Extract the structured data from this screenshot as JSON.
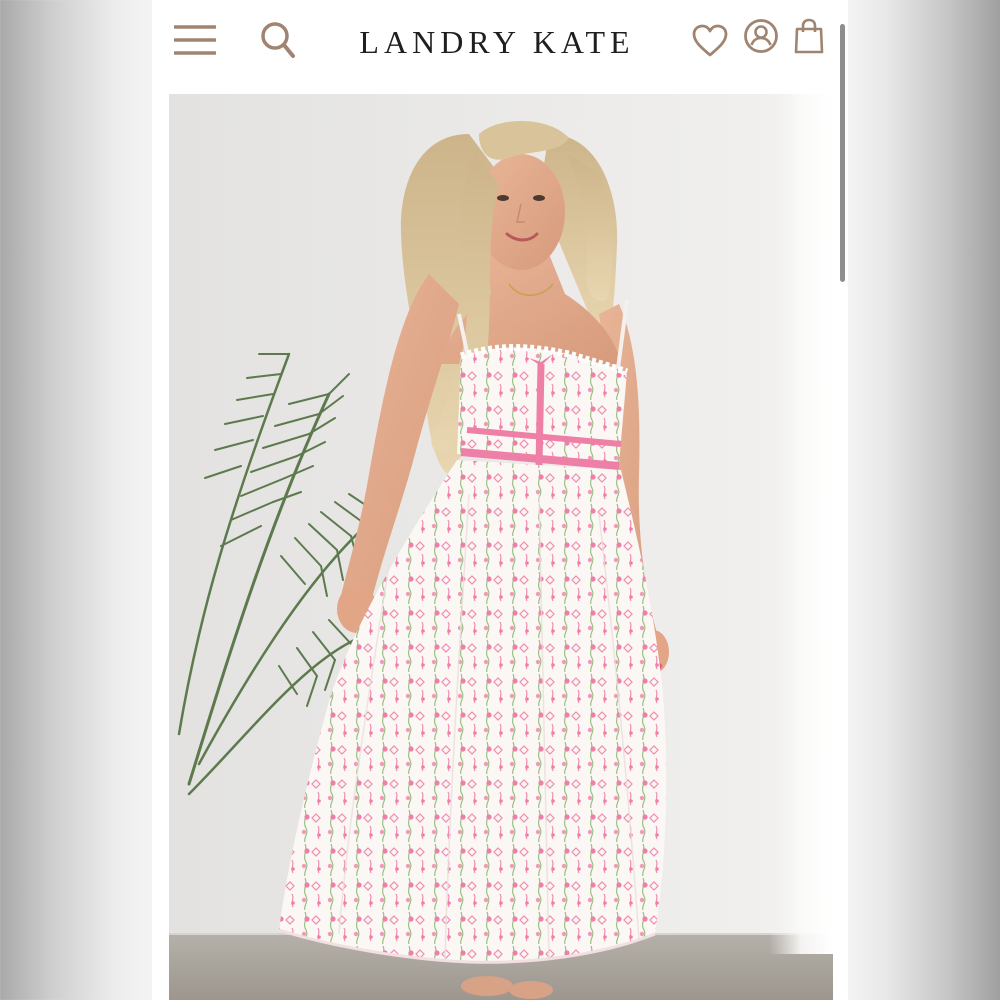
{
  "header": {
    "brand": "LANDRY KATE",
    "icons": [
      "menu-icon",
      "search-icon",
      "heart-icon",
      "account-icon",
      "bag-icon"
    ]
  },
  "colors": {
    "icon_tan": "#a08470",
    "brand_text": "#1f1f1f",
    "dress_pink": "#ee7fa6",
    "dress_base": "#fbf7f4",
    "wall": "#ecebe9",
    "floor": "#a9a39b"
  }
}
